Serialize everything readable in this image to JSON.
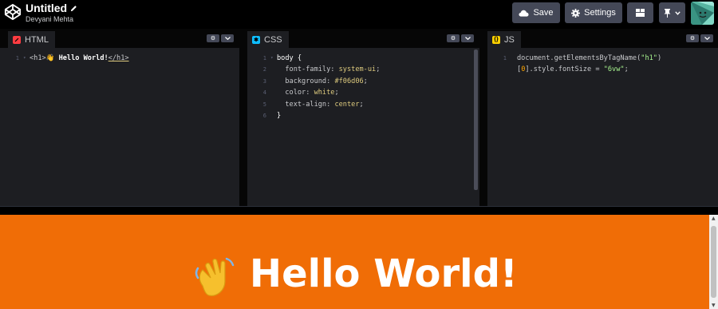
{
  "header": {
    "title": "Untitled",
    "author": "Devyani Mehta",
    "save_label": "Save",
    "settings_label": "Settings"
  },
  "panels": {
    "html": {
      "label": "HTML",
      "icon_color": "#ff3c41"
    },
    "css": {
      "label": "CSS",
      "icon_color": "#0ebeff"
    },
    "js": {
      "label": "JS",
      "icon_color": "#fcd000"
    }
  },
  "code": {
    "html": {
      "line_numbers": [
        "1"
      ],
      "open_tag": "<h1>",
      "emoji": "👋",
      "content": " Hello World!",
      "close_tag": "</h1>"
    },
    "css": {
      "line_numbers": [
        "1",
        "2",
        "3",
        "4",
        "5",
        "6"
      ],
      "selector": "body",
      "open_brace": " {",
      "decls": [
        {
          "prop": "  font-family",
          "val": "system-ui"
        },
        {
          "prop": "  background",
          "val": "#f06d06"
        },
        {
          "prop": "  color",
          "val": "white"
        },
        {
          "prop": "  text-align",
          "val": "center"
        }
      ],
      "close_brace": "}"
    },
    "js": {
      "line_numbers": [
        "1"
      ],
      "l1_obj": "document",
      "l1_dot": ".",
      "l1_fn": "getElementsByTagName",
      "l1_open": "(",
      "l1_arg": "\"h1\"",
      "l1_close": ")",
      "l2_open": "[",
      "l2_index": "0",
      "l2_rest": "].style.fontSize = ",
      "l2_str": "\"6vw\"",
      "l2_end": ";"
    }
  },
  "preview": {
    "background": "#f06d06",
    "emoji": "👋",
    "heading": "Hello World!"
  },
  "colors": {
    "accent_bg": "#444857"
  }
}
